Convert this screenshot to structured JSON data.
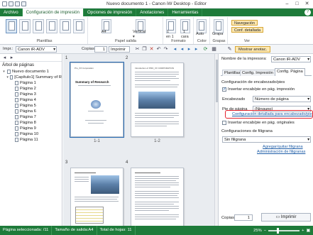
{
  "window": {
    "title": "Nuevo documento 1 - Canon iW Desktop - Editor"
  },
  "menu": {
    "tabs": [
      "Archivo",
      "Configuración de impresión",
      "Opciones de impresión",
      "Anotaciones",
      "Herramientas"
    ],
    "active_index": 1,
    "help": "?"
  },
  "ribbon": {
    "groups": {
      "plantillas": "Plantillas",
      "papel": "Papel salida",
      "formato": "Formato",
      "color": "Color",
      "grapas": "Grapas",
      "ver": "Ver"
    },
    "paper_size": "A4",
    "orientation": "Vertical",
    "layout_one": "1",
    "layout_one_label": "en 1",
    "layout_side": "1",
    "layout_side_label": "cara",
    "color_value": "Auto",
    "staple_value": "Grapa",
    "view_navegacion": "Navegación",
    "view_conf": "Conf. detallada"
  },
  "toolbar": {
    "impr_label": "Impr.:",
    "printer": "Canon iR-ADV",
    "copias_label": "Copias:",
    "copias_value": "1",
    "imprimir": "Imprimir",
    "mostrar_anotac": "Mostrar anotac."
  },
  "left_panel": {
    "title": "Árbol de páginas",
    "root": "Nuevo documento 1",
    "doc": "[Capítulo1] Summary of R",
    "pages": [
      "Página 1",
      "Página 2",
      "Página 3",
      "Página 4",
      "Página 5",
      "Página 6",
      "Página 7",
      "Página 8",
      "Página 9",
      "Página 10",
      "Página 11"
    ]
  },
  "center": {
    "page_numbers": [
      "1",
      "2",
      "3",
      "4"
    ],
    "captions": [
      "1-1",
      "1-2"
    ],
    "thumb1_title": "Summary of Research",
    "thumb1_header": "Pro_XX Corporation",
    "thumb2_header": "Introduction of PRO_XX CORPORATION"
  },
  "right_panel": {
    "printer_label": "Nombre de la impresora:",
    "printer": "Canon iR-ADV",
    "tabs": [
      "Plantillas",
      "Config. Impresión",
      "Config. Página"
    ],
    "active_tab": 2,
    "section1": "Configuración de encabezado/pies",
    "chk_insert": "Insertar encab/pie en pág. impresión",
    "encabezado_label": "Encabezado",
    "encabezado_value": "Número de página",
    "pie_label": "Pie de página",
    "pie_value": "(Ninguno)",
    "detail_link": "Configuración detallada para encabezado/pie",
    "chk_original": "Insertar encab/pie en pág. originales",
    "section2": "Configuraciones de filigrana",
    "filigrana_value": "Sin filigrana",
    "agregar_link": "Agregar/quitar filigrana",
    "admin_link": "Administración de filigranas",
    "copias_label": "Copias:",
    "copias_value": "1",
    "imprimir": "Imprimir"
  },
  "status": {
    "selected": "Página seleccionada: /11",
    "size": "Tamaño de salida:A4",
    "total": "Total de hojas: 11",
    "zoom": "25%",
    "zoom_fraction": 0.3
  }
}
